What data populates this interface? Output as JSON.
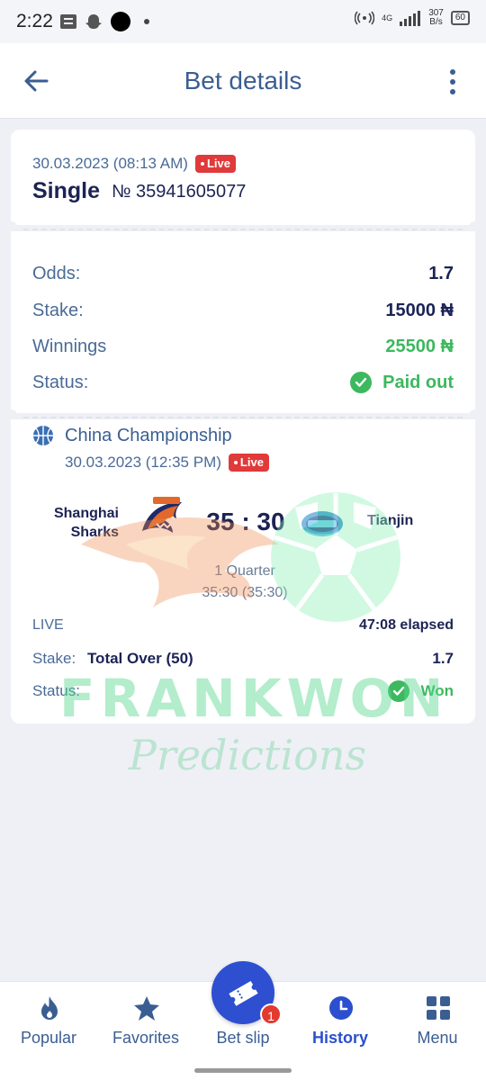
{
  "status_bar": {
    "time": "2:22",
    "network_speed": "307",
    "speed_unit": "B/s",
    "battery": "60",
    "net_type": "4G"
  },
  "header": {
    "title": "Bet details",
    "back_icon": "arrow-left-icon",
    "more_icon": "more-vertical-icon"
  },
  "bet": {
    "date": "30.03.2023 (08:13 AM)",
    "live_label": "Live",
    "type": "Single",
    "number": "№ 35941605077",
    "details": {
      "odds_label": "Odds:",
      "odds_value": "1.7",
      "stake_label": "Stake:",
      "stake_value": "15000 ₦",
      "winnings_label": "Winnings",
      "winnings_value": "25500 ₦",
      "status_label": "Status:",
      "status_value": "Paid out"
    }
  },
  "event": {
    "league": "China Championship",
    "date": "30.03.2023 (12:35 PM)",
    "live_label": "Live",
    "team1_line1": "Shanghai",
    "team1_line2": "Sharks",
    "team2": "Tianjin",
    "score": "35 : 30",
    "period": "1 Quarter",
    "period_score": "35:30 (35:30)",
    "live_text": "LIVE",
    "elapsed": "47:08 elapsed",
    "stake_label": "Stake:",
    "market": "Total Over (50)",
    "market_odds": "1.7",
    "status_label": "Status:",
    "status_value": "Won"
  },
  "watermark": {
    "title": "FRANKWON",
    "subtitle": "Predictions"
  },
  "bottom_nav": {
    "items": [
      {
        "label": "Popular",
        "icon": "flame-icon"
      },
      {
        "label": "Favorites",
        "icon": "star-icon"
      },
      {
        "label": "Bet slip",
        "icon": "ticket-icon"
      },
      {
        "label": "History",
        "icon": "clock-icon"
      },
      {
        "label": "Menu",
        "icon": "grid-icon"
      }
    ],
    "active": "History",
    "bet_slip_count": "1"
  },
  "colors": {
    "primary": "#2f4fd1",
    "title_blue": "#3a5e92",
    "live_red": "#e03a3a",
    "success_green": "#3db85e",
    "text_dark": "#1c2354"
  }
}
